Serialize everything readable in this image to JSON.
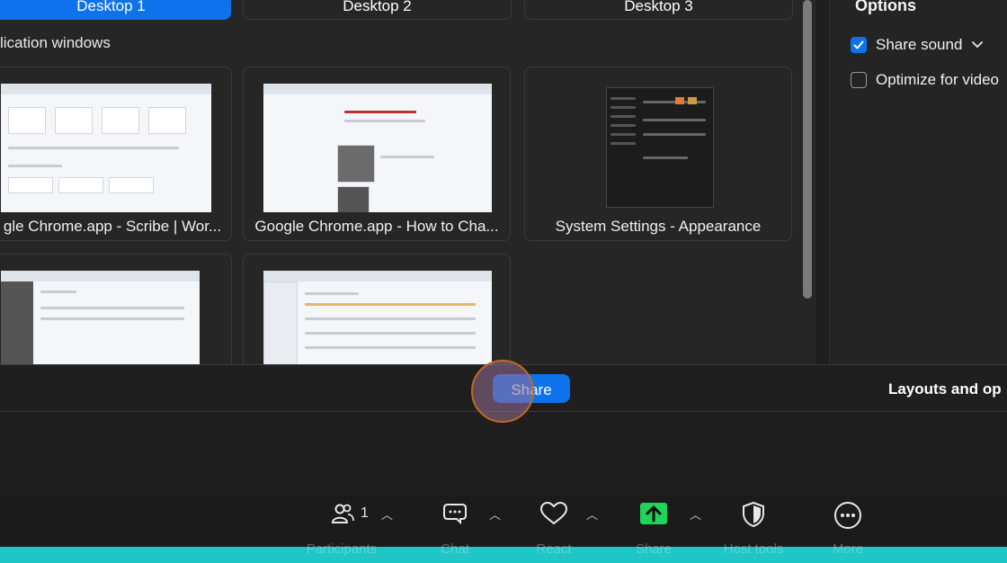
{
  "desktop_tabs": [
    "Desktop 1",
    "Desktop 2",
    "Desktop 3"
  ],
  "section_title": "lication windows",
  "windows": [
    {
      "caption": "gle Chrome.app - Scribe | Wor..."
    },
    {
      "caption": "Google Chrome.app - How to Cha..."
    },
    {
      "caption": "System Settings - Appearance"
    },
    {
      "caption": ""
    },
    {
      "caption": ""
    }
  ],
  "options": {
    "title": "Options",
    "share_sound": "Share sound",
    "share_sound_checked": true,
    "optimize_video": "Optimize for video",
    "optimize_video_checked": false
  },
  "share_button": "Share",
  "layouts_label": "Layouts and op",
  "toolbar": {
    "participants_label": "Participants",
    "participants_count": "1",
    "chat_label": "Chat",
    "react_label": "React",
    "share_label": "Share",
    "host_tools_label": "Host tools",
    "more_label": "More"
  },
  "colors": {
    "accent": "#0e72ed",
    "share_green": "#1fd45a",
    "teal_strip": "#1ec6c6",
    "highlight_ring": "#c06a22"
  }
}
